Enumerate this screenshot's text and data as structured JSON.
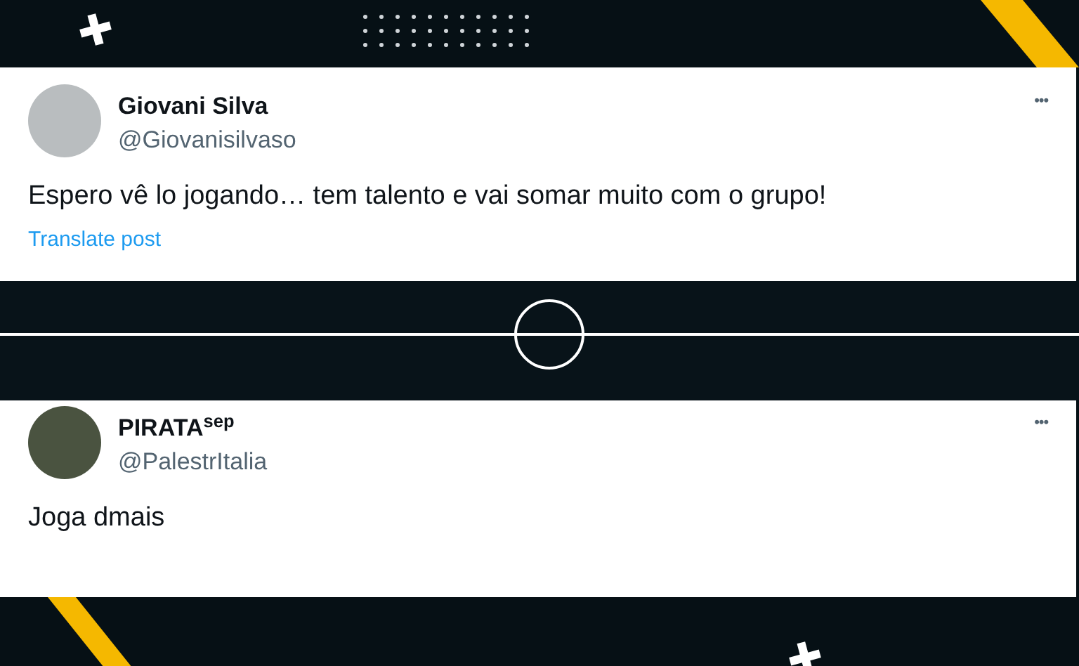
{
  "posts": [
    {
      "name": "Giovani Silva",
      "handle": "@Giovanisilvaso",
      "text": "Espero vê lo jogando… tem talento e vai somar muito com o grupo!",
      "translate": "Translate post",
      "more": "•••"
    },
    {
      "name": "PIRATA$^{sep}$",
      "handle": "@PalestrItalia",
      "text": "Joga dmais",
      "more": "•••"
    }
  ]
}
